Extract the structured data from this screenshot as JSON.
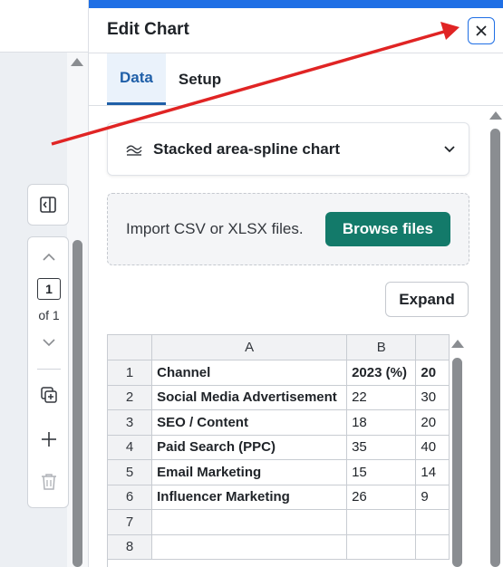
{
  "panel": {
    "title": "Edit Chart",
    "tabs": [
      {
        "label": "Data",
        "active": true
      },
      {
        "label": "Setup",
        "active": false
      }
    ],
    "chart_type": "Stacked area-spline chart",
    "import_text": "Import CSV or XLSX files.",
    "browse_label": "Browse files",
    "expand_label": "Expand"
  },
  "page_nav": {
    "current": "1",
    "of_label": "of 1"
  },
  "sheet": {
    "columns": [
      "A",
      "B"
    ],
    "rows": [
      {
        "num": "1",
        "a": "Channel",
        "b": "2023 (%)",
        "c": "20"
      },
      {
        "num": "2",
        "a": "Social Media Advertisement",
        "b": "22",
        "c": "30"
      },
      {
        "num": "3",
        "a": "SEO / Content",
        "b": "18",
        "c": "20"
      },
      {
        "num": "4",
        "a": "Paid Search (PPC)",
        "b": "35",
        "c": "40"
      },
      {
        "num": "5",
        "a": "Email Marketing",
        "b": "15",
        "c": "14"
      },
      {
        "num": "6",
        "a": "Influencer Marketing",
        "b": "26",
        "c": "9"
      },
      {
        "num": "7",
        "a": "",
        "b": "",
        "c": ""
      },
      {
        "num": "8",
        "a": "",
        "b": "",
        "c": ""
      }
    ]
  },
  "colors": {
    "accent": "#1f6fe5",
    "tab_active": "#1f5fa8",
    "browse": "#137a6a",
    "arrow": "#e02424"
  }
}
